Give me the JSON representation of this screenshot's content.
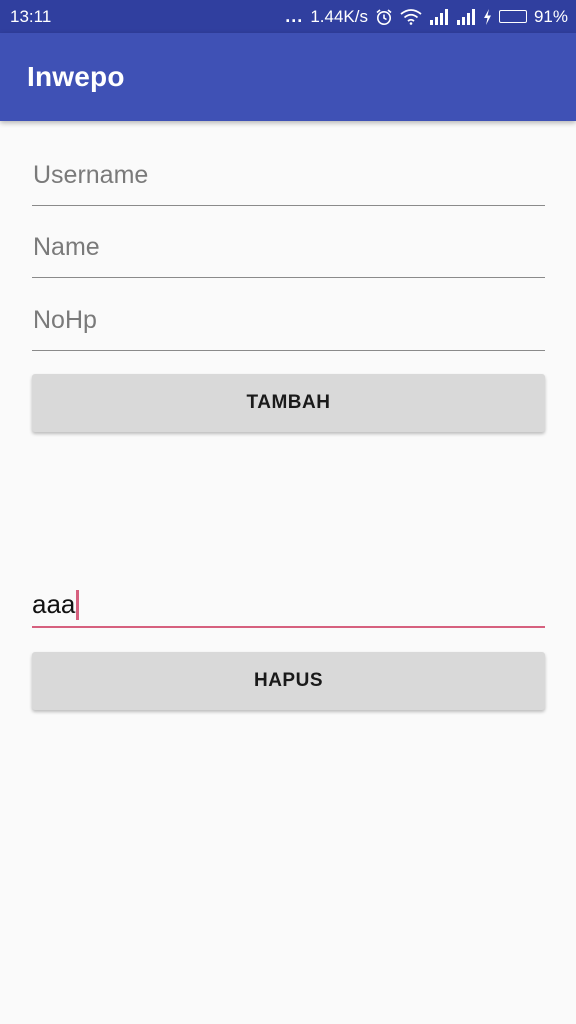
{
  "status_bar": {
    "time": "13:11",
    "dots": "...",
    "network_speed": "1.44K/s",
    "battery_percent": "91%",
    "battery_level": 0.91,
    "icons": [
      "alarm-icon",
      "wifi-icon",
      "signal-icon",
      "signal-icon",
      "charging-icon",
      "battery-icon"
    ]
  },
  "app_bar": {
    "title": "Inwepo"
  },
  "form": {
    "username_placeholder": "Username",
    "name_placeholder": "Name",
    "nohp_placeholder": "NoHp",
    "add_button_label": "TAMBAH"
  },
  "delete_section": {
    "input_value": "aaa",
    "delete_button_label": "HAPUS"
  },
  "colors": {
    "status_bar": "#303f9f",
    "app_bar": "#3f51b5",
    "accent": "#d6607e",
    "background": "#fafafa",
    "button": "#d9d9d9"
  }
}
